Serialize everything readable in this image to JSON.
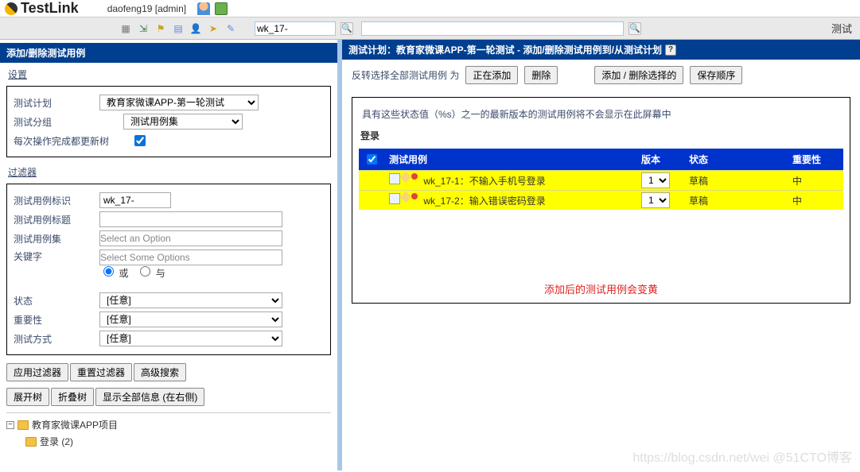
{
  "brand": "TestLink",
  "user_text": "daofeng19 [admin]",
  "search_value": "wk_17-",
  "right_word": "测试",
  "left": {
    "title": "添加/删除测试用例",
    "settings_header": "设置",
    "plan_label": "测试计划",
    "plan_value": "教育家微课APP-第一轮测试",
    "group_label": "测试分组",
    "group_value": "测试用例集",
    "refresh_label": "每次操作完成都更新树",
    "filter_header": "过滤器",
    "f_id_label": "测试用例标识",
    "f_id_value": "wk_17-",
    "f_title_label": "测试用例标题",
    "f_suite_label": "测试用例集",
    "f_suite_placeholder": "Select an Option",
    "f_kw_label": "关键字",
    "f_kw_placeholder": "Select Some Options",
    "radio_or": "或",
    "radio_and": "与",
    "f_status_label": "状态",
    "f_importance_label": "重要性",
    "f_exec_label": "测试方式",
    "any": "[任意]",
    "btn_apply": "应用过滤器",
    "btn_reset": "重置过滤器",
    "btn_adv": "高级搜索",
    "btn_expand": "展开树",
    "btn_collapse": "折叠树",
    "btn_showall": "显示全部信息 (在右侧)",
    "tree_root": "教育家微课APP项目",
    "tree_child": "登录 (2)"
  },
  "right": {
    "title": "测试计划：教育家微课APP-第一轮测试 - 添加/删除测试用例到/从测试计划",
    "invert_text": "反转选择全部测试用例 为",
    "btn_adding": "正在添加",
    "btn_del": "删除",
    "btn_addrem": "添加 / 删除选择的",
    "btn_save": "保存顺序",
    "notice": "具有这些状态值（%s）之一的最新版本的测试用例将不会显示在此屏幕中",
    "subhead": "登录",
    "th_tc": "测试用例",
    "th_ver": "版本",
    "th_status": "状态",
    "th_imp": "重要性",
    "rows": [
      {
        "name": "wk_17-1：不输入手机号登录",
        "ver": "1",
        "status": "草稿",
        "imp": "中"
      },
      {
        "name": "wk_17-2：输入错误密码登录",
        "ver": "1",
        "status": "草稿",
        "imp": "中"
      }
    ],
    "red_note": "添加后的测试用例会变黄"
  },
  "watermark": "https://blog.csdn.net/wei @51CTO博客"
}
